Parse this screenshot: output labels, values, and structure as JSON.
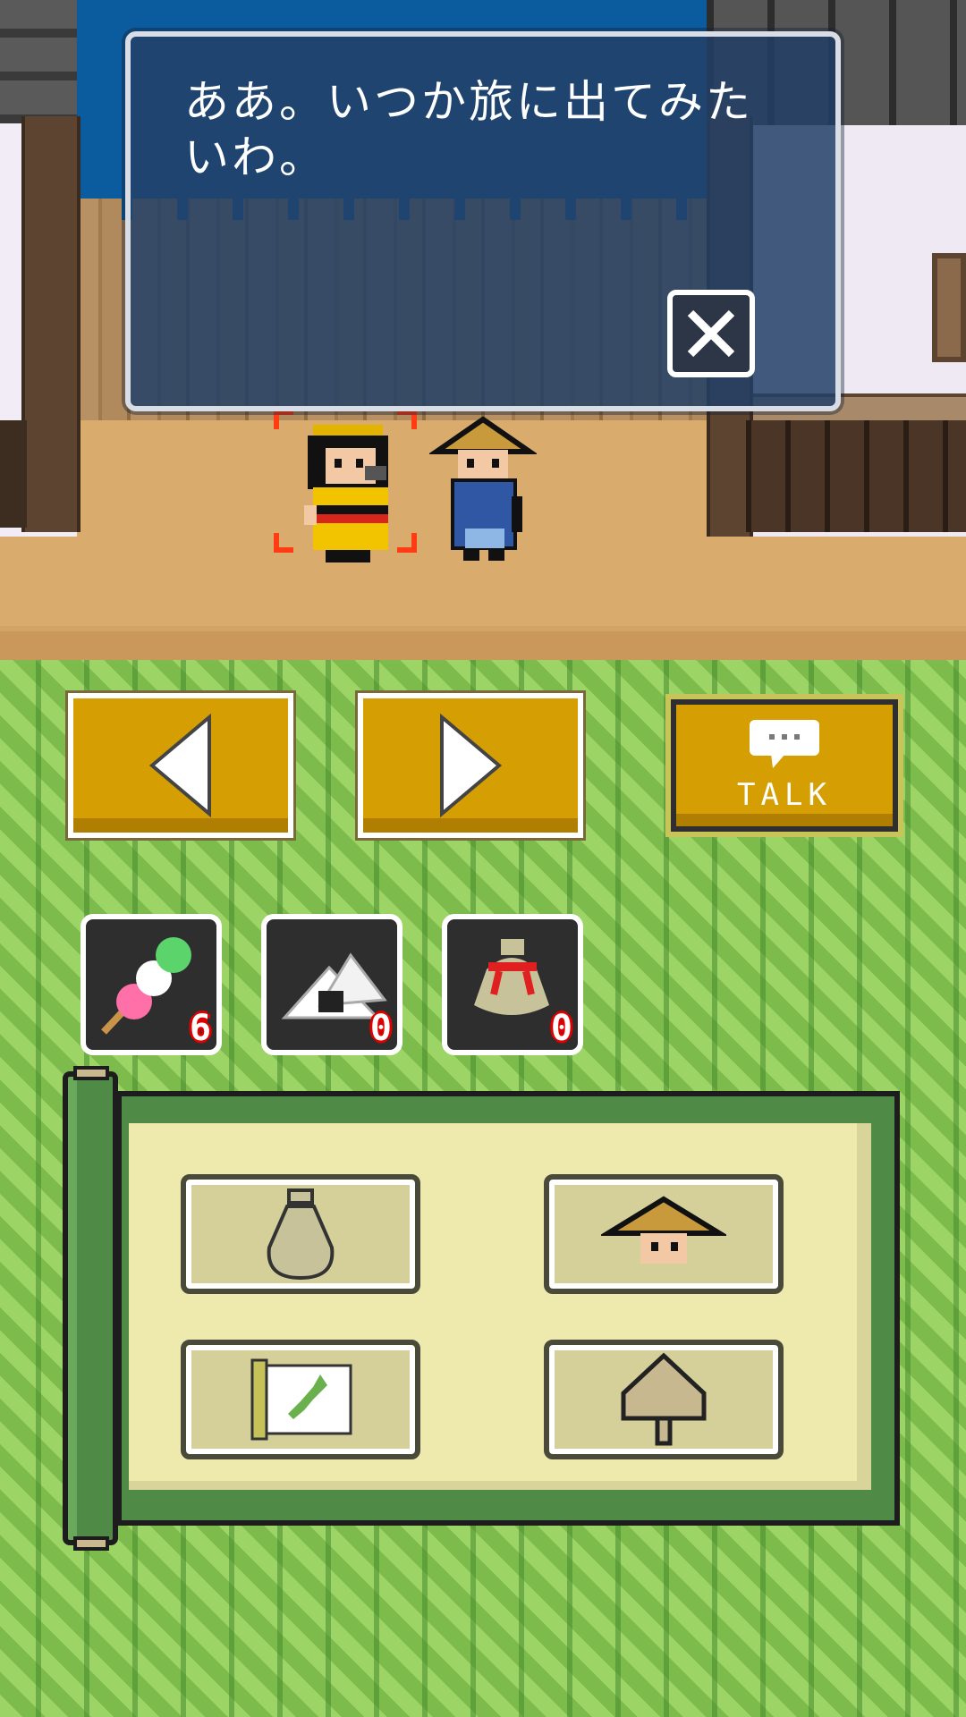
{
  "dialog": {
    "text": "ああ。いつか旅に出てみたいわ。",
    "close_label": "✕"
  },
  "controls": {
    "left_button": "previous-arrow",
    "right_button": "next-arrow",
    "talk_label": "TALK"
  },
  "items": [
    {
      "name": "dango",
      "count": "6"
    },
    {
      "name": "onigiri",
      "count": "0"
    },
    {
      "name": "pouch",
      "count": "0"
    }
  ],
  "menu": [
    {
      "icon": "bag-icon"
    },
    {
      "icon": "traveler-icon"
    },
    {
      "icon": "map-scroll-icon"
    },
    {
      "icon": "signpost-icon"
    }
  ],
  "colors": {
    "button_gold": "#d59f04",
    "dialog_bg": "#224066",
    "panel_green": "#4f8a47",
    "panel_paper": "#eeeaae",
    "count_red": "#e00000"
  }
}
